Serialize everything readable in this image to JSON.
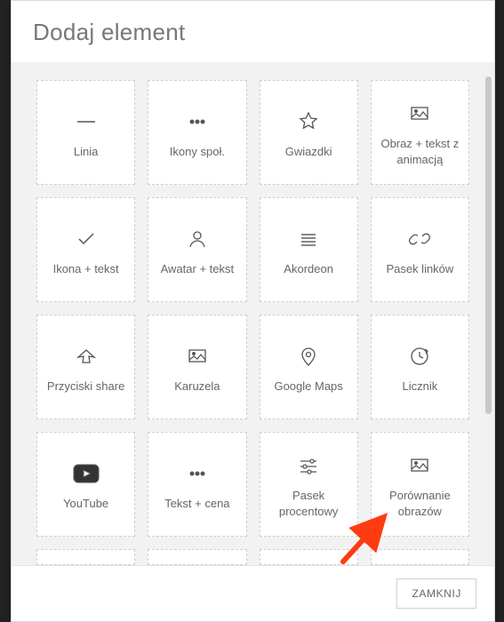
{
  "dialog": {
    "title": "Dodaj element",
    "close_label": "ZAMKNIJ"
  },
  "tiles": [
    {
      "id": "line",
      "icon": "line-icon",
      "label": "Linia"
    },
    {
      "id": "social-icons",
      "icon": "dots-icon",
      "label": "Ikony społ."
    },
    {
      "id": "rating-stars",
      "icon": "star-icon",
      "label": "Gwiazdki"
    },
    {
      "id": "image-text-anim",
      "icon": "image-icon",
      "label": "Obraz + tekst z animacją"
    },
    {
      "id": "icon-text",
      "icon": "check-icon",
      "label": "Ikona + tekst"
    },
    {
      "id": "avatar-text",
      "icon": "avatar-icon",
      "label": "Awatar + tekst"
    },
    {
      "id": "accordion",
      "icon": "accordion-icon",
      "label": "Akordeon"
    },
    {
      "id": "link-bar",
      "icon": "link-icon",
      "label": "Pasek linków"
    },
    {
      "id": "share-buttons",
      "icon": "share-icon",
      "label": "Przyciski share"
    },
    {
      "id": "carousel",
      "icon": "image-icon",
      "label": "Karuzela"
    },
    {
      "id": "google-maps",
      "icon": "map-pin-icon",
      "label": "Google Maps"
    },
    {
      "id": "counter",
      "icon": "clock-icon",
      "label": "Licznik"
    },
    {
      "id": "youtube",
      "icon": "youtube-icon",
      "label": "YouTube"
    },
    {
      "id": "text-price",
      "icon": "dots-icon",
      "label": "Tekst + cena"
    },
    {
      "id": "progress-bar",
      "icon": "sliders-icon",
      "label": "Pasek procentowy"
    },
    {
      "id": "image-compare",
      "icon": "image-icon",
      "label": "Porównanie obrazów"
    }
  ],
  "annotation": {
    "arrow_color": "#ff3b12"
  }
}
